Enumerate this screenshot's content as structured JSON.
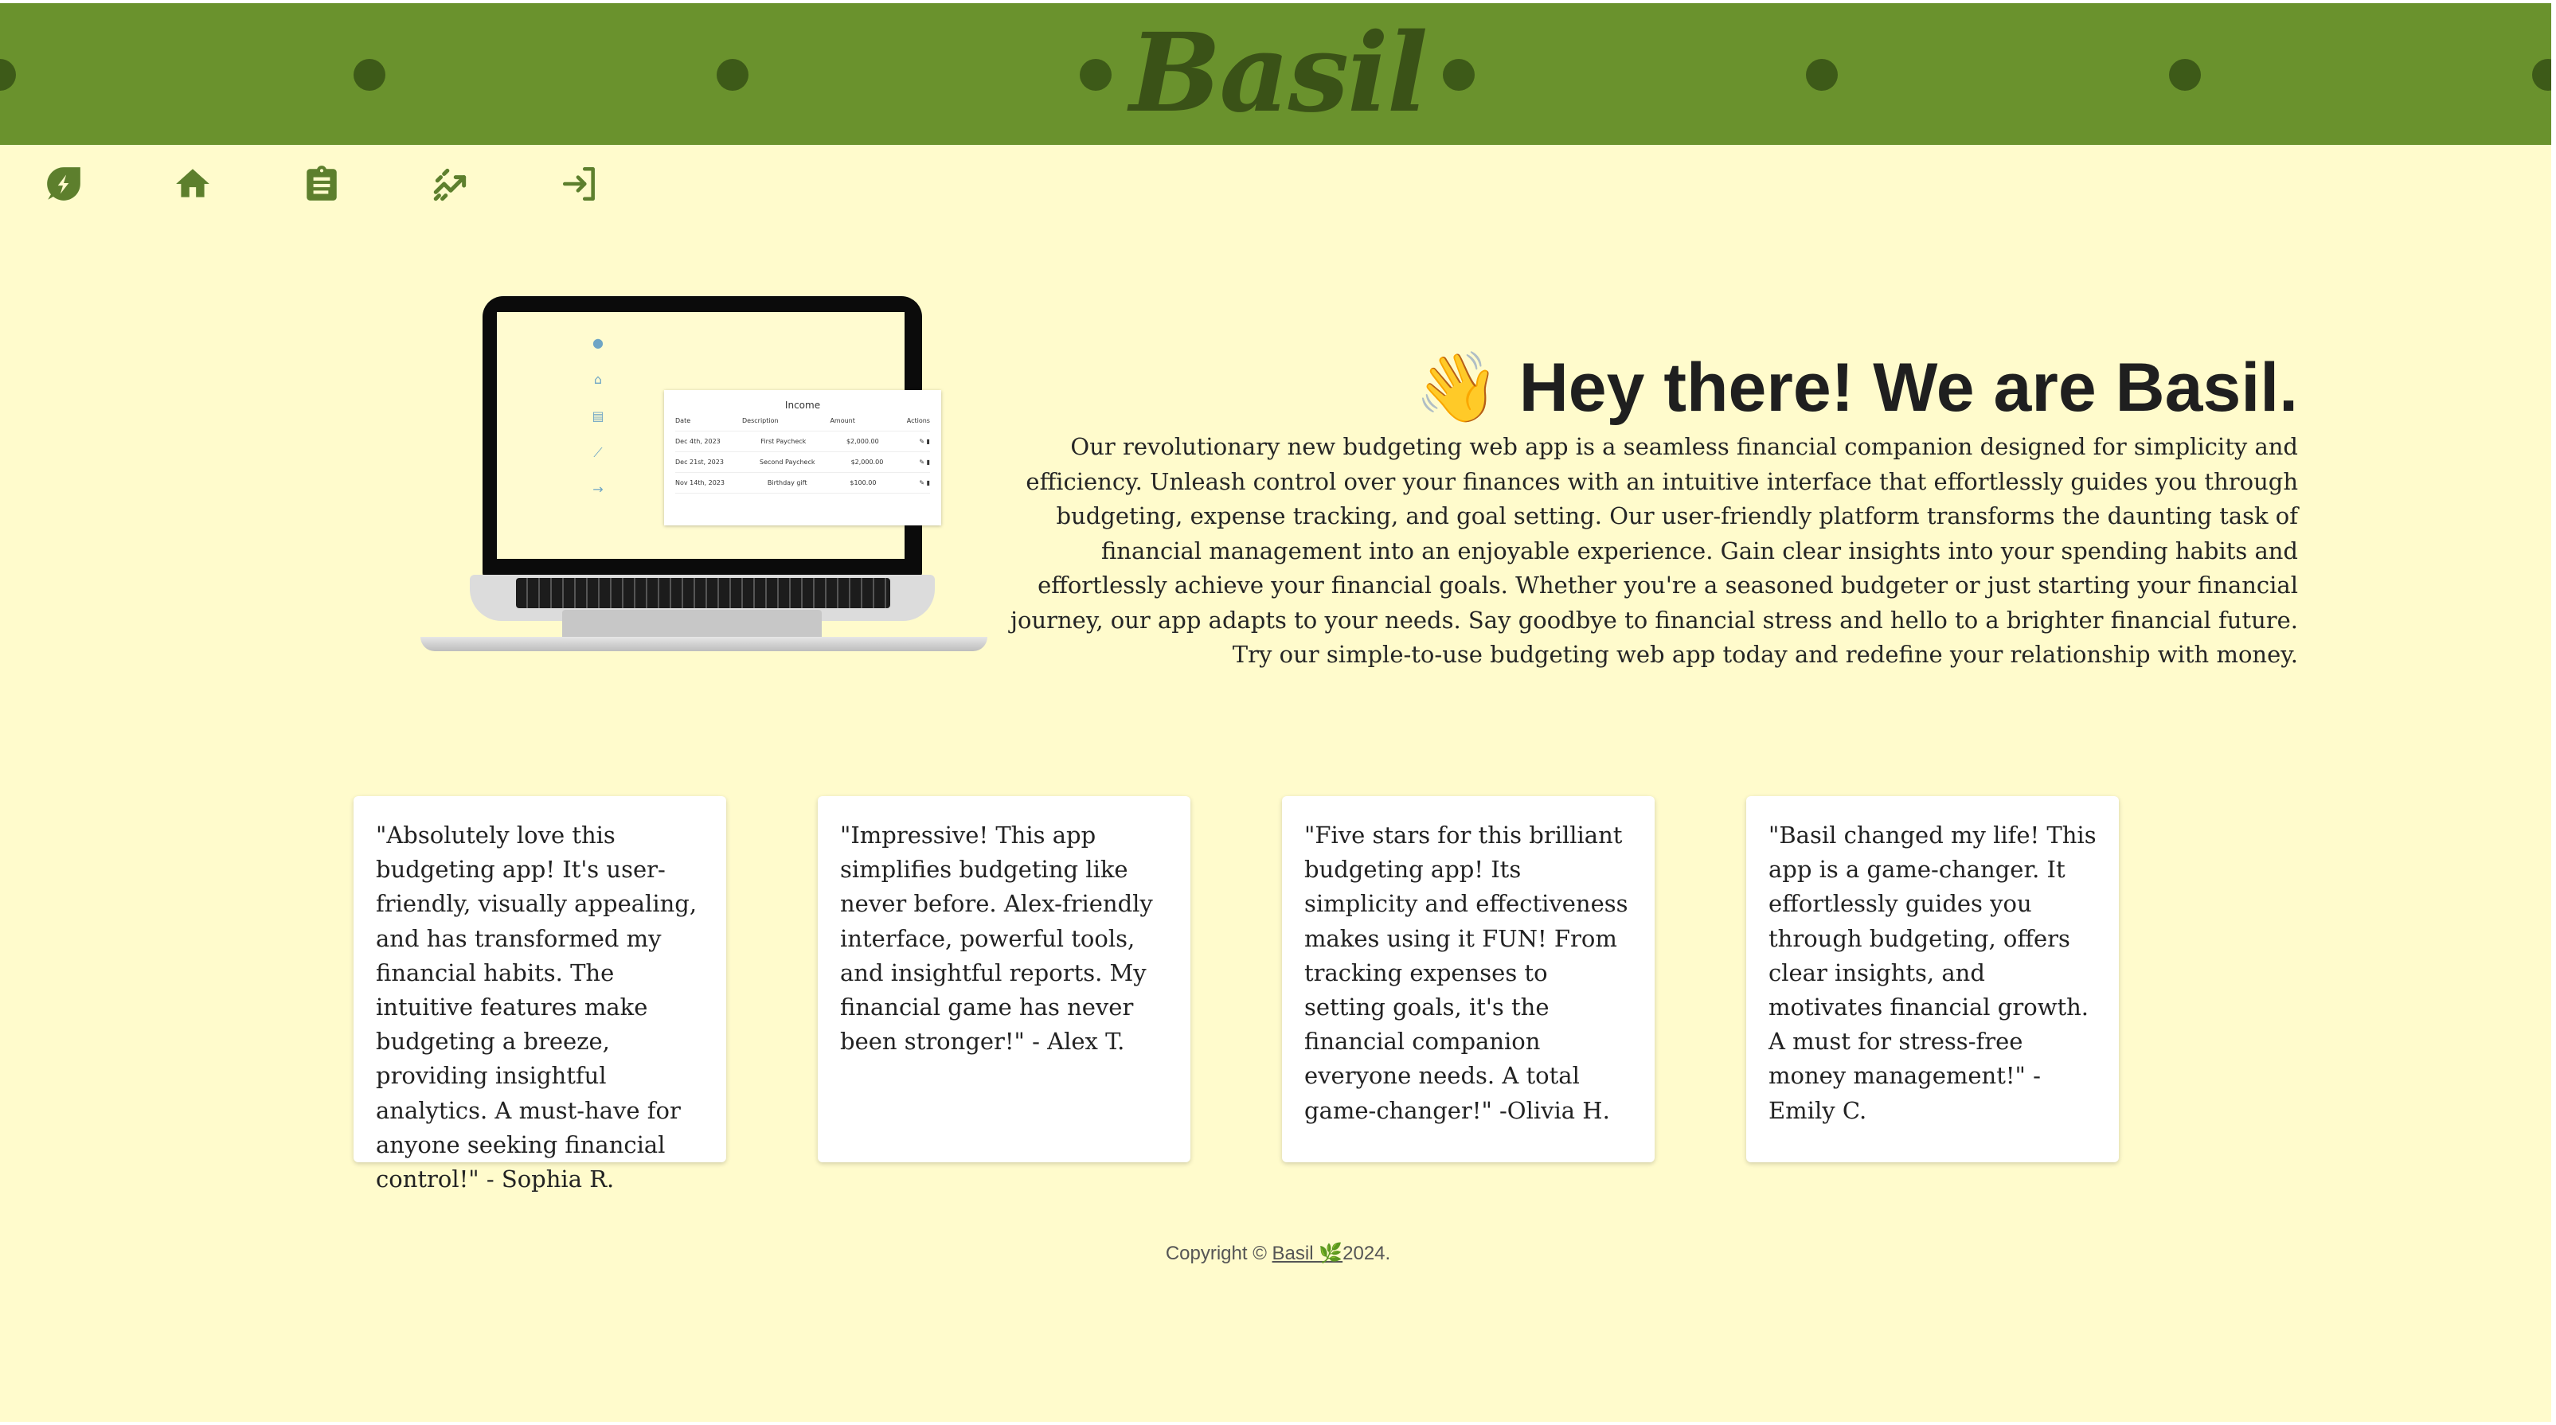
{
  "app": {
    "brand": "Basil"
  },
  "nav": {
    "items": [
      {
        "name": "logo-leaf-icon"
      },
      {
        "name": "home-icon"
      },
      {
        "name": "clipboard-icon"
      },
      {
        "name": "analytics-icon"
      },
      {
        "name": "login-icon"
      }
    ]
  },
  "colors": {
    "header": "#6a922d",
    "background": "#fffbcc",
    "icon": "#5d7f2d"
  },
  "laptop_preview": {
    "title": "Income",
    "columns": [
      "Date",
      "Description",
      "Amount",
      "Actions"
    ],
    "rows": [
      [
        "Dec 4th, 2023",
        "First Paycheck",
        "$2,000.00"
      ],
      [
        "Dec 21st, 2023",
        "Second Paycheck",
        "$2,000.00"
      ],
      [
        "Nov 14th, 2023",
        "Birthday gift",
        "$100.00"
      ]
    ]
  },
  "hero": {
    "emoji": "👋",
    "title": "Hey there! We are Basil.",
    "body": "Our revolutionary new budgeting web app is a seamless financial companion designed for simplicity and efficiency. Unleash control over your finances with an intuitive interface that effortlessly guides you through budgeting, expense tracking, and goal setting. Our user-friendly platform transforms the daunting task of financial management into an enjoyable experience. Gain clear insights into your spending habits and effortlessly achieve your financial goals. Whether you're a seasoned budgeter or just starting your financial journey, our app adapts to your needs. Say goodbye to financial stress and hello to a brighter financial future. Try our simple-to-use budgeting web app today and redefine your relationship with money."
  },
  "testimonials": [
    "\"Absolutely love this budgeting app! It's user-friendly, visually appealing, and has transformed my financial habits. The intuitive features make budgeting a breeze, providing insightful analytics. A must-have for anyone seeking financial control!\" - Sophia R.",
    "\"Impressive! This app simplifies budgeting like never before. Alex-friendly interface, powerful tools, and insightful reports. My financial game has never been stronger!\" - Alex T.",
    "\"Five stars for this brilliant budgeting app! Its simplicity and effectiveness makes using it FUN! From tracking expenses to setting goals, it's the financial companion everyone needs. A total game-changer!\" -Olivia H.",
    "\"Basil changed my life! This app is a game-changer. It effortlessly guides you through budgeting, offers clear insights, and motivates financial growth. A must for stress-free money management!\" -Emily C."
  ],
  "footer": {
    "prefix": "Copyright © ",
    "link": "Basil 🌿",
    "suffix": "2024."
  }
}
